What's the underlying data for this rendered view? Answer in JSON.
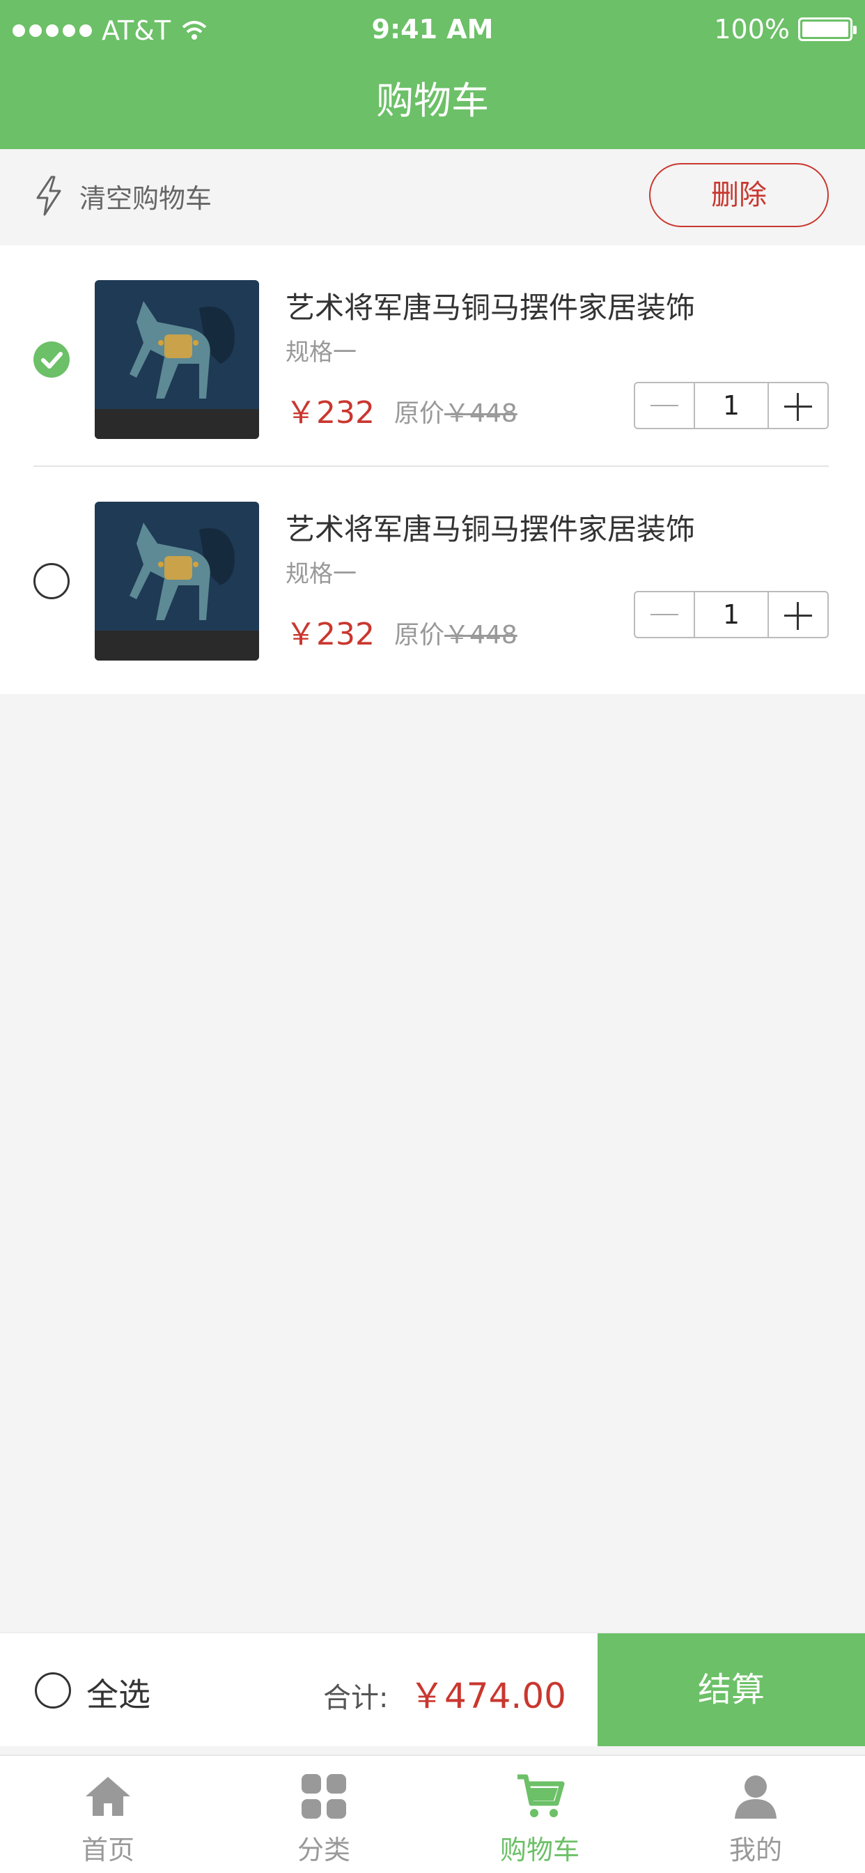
{
  "status_bar": {
    "carrier": "AT&T",
    "time": "9:41 AM",
    "battery": "100%"
  },
  "header": {
    "title": "购物车"
  },
  "toolbar": {
    "clear_label": "清空购物车",
    "delete_label": "删除"
  },
  "items": [
    {
      "name": "艺术将军唐马铜马摆件家居装饰",
      "spec": "规格一",
      "price": "￥232",
      "orig_label": "原价",
      "orig_price": "￥448",
      "qty": "1",
      "checked": true
    },
    {
      "name": "艺术将军唐马铜马摆件家居装饰",
      "spec": "规格一",
      "price": "￥232",
      "orig_label": "原价",
      "orig_price": "￥448",
      "qty": "1",
      "checked": false
    }
  ],
  "summary": {
    "select_all": "全选",
    "total_label": "合计:",
    "total_value": "￥474.00",
    "checkout": "结算"
  },
  "tabs": [
    {
      "label": "首页",
      "icon": "home-icon"
    },
    {
      "label": "分类",
      "icon": "category-icon"
    },
    {
      "label": "购物车",
      "icon": "cart-icon"
    },
    {
      "label": "我的",
      "icon": "profile-icon"
    }
  ],
  "colors": {
    "primary": "#6cc067",
    "accent": "#c9372f"
  }
}
